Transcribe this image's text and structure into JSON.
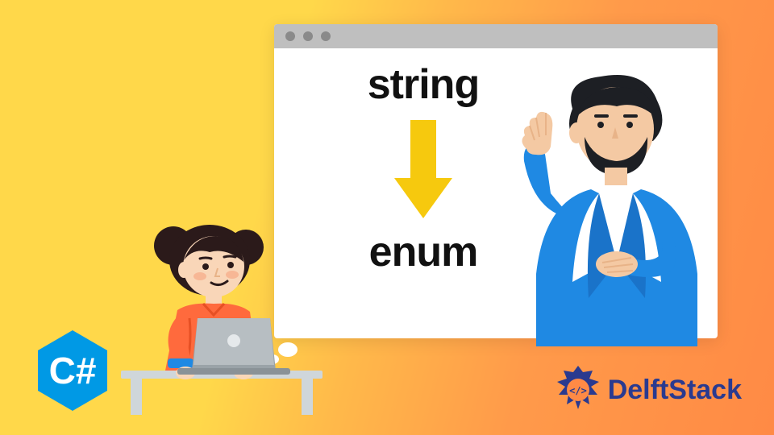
{
  "window": {
    "word_top": "string",
    "word_bottom": "enum"
  },
  "badge": {
    "label": "C#"
  },
  "brand": {
    "name": "DelftStack"
  },
  "colors": {
    "arrow": "#f6c90e",
    "csharp_bg": "#0099e5",
    "brand_text": "#2a3a8f",
    "man_jacket": "#1f89e3",
    "girl_shirt": "#ff6a3d"
  }
}
